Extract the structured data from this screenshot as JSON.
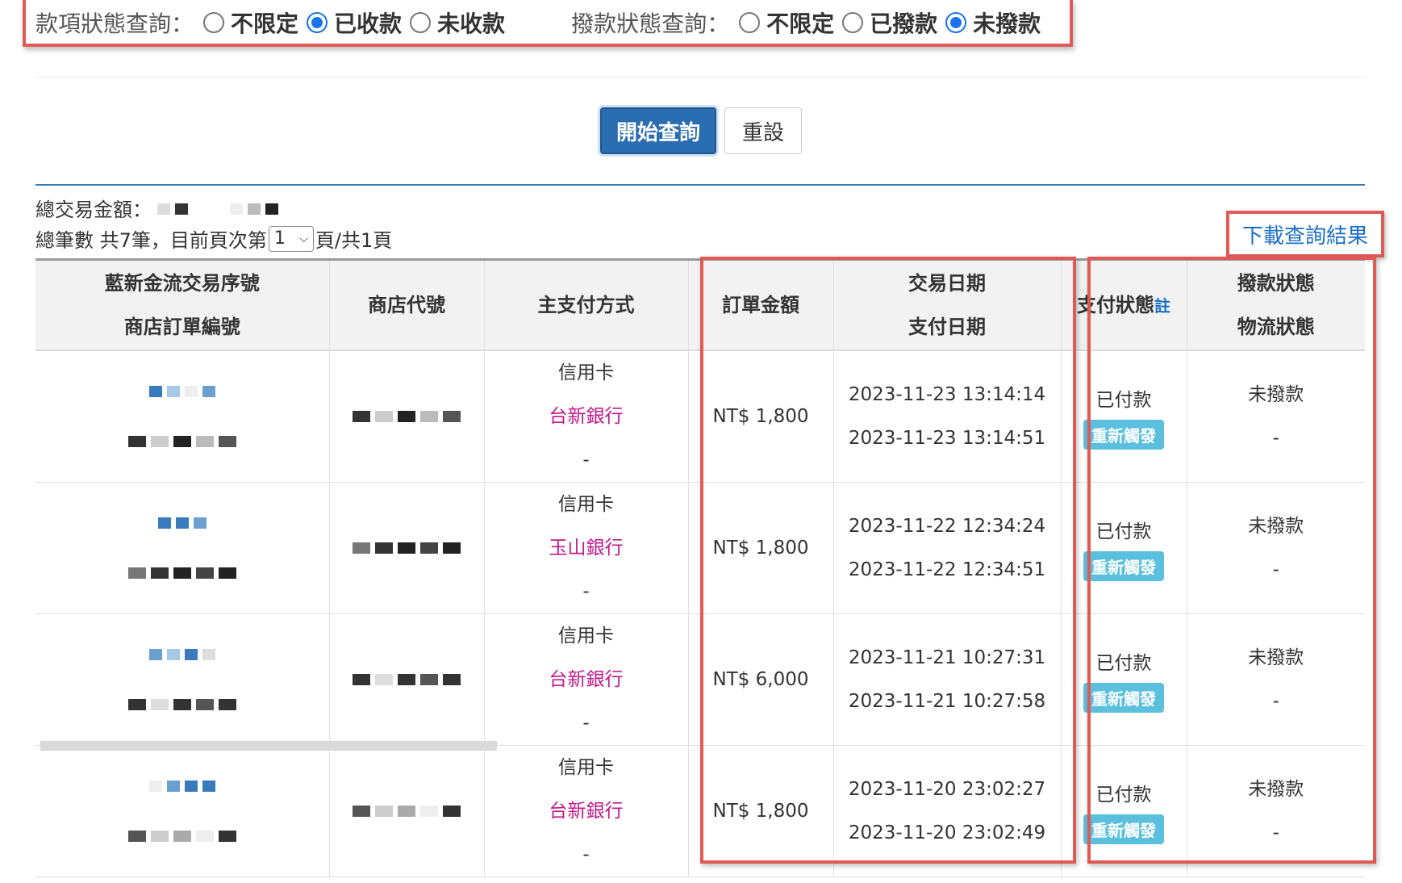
{
  "filters": {
    "payment_label": "款項狀態查詢：",
    "payment_options": [
      {
        "label": "不限定",
        "checked": false
      },
      {
        "label": "已收款",
        "checked": true
      },
      {
        "label": "未收款",
        "checked": false
      }
    ],
    "remit_label": "撥款狀態查詢：",
    "remit_options": [
      {
        "label": "不限定",
        "checked": false
      },
      {
        "label": "已撥款",
        "checked": false
      },
      {
        "label": "未撥款",
        "checked": true
      }
    ]
  },
  "buttons": {
    "search": "開始查詢",
    "reset": "重設"
  },
  "summary": {
    "total_amount_label": "總交易金額：",
    "total_count_prefix": "總筆數 共7筆，目前頁次第",
    "page_value": "1",
    "page_suffix": "頁/共1頁"
  },
  "download_label": "下載查詢結果",
  "table": {
    "headers": {
      "trade_no": "藍新金流交易序號",
      "order_no": "商店訂單編號",
      "merchant_id": "商店代號",
      "payment_method": "主支付方式",
      "order_amount": "訂單金額",
      "trade_date": "交易日期",
      "pay_date": "支付日期",
      "pay_status": "支付狀態",
      "pay_status_note": "註",
      "remit_status": "撥款狀態",
      "logistics_status": "物流狀態"
    },
    "rows": [
      {
        "method": "信用卡",
        "bank": "台新銀行",
        "extra": "-",
        "amount": "NT$ 1,800",
        "trade_date": "2023-11-23 13:14:14",
        "pay_date": "2023-11-23 13:14:51",
        "pay_status": "已付款",
        "resend": "重新觸發",
        "remit": "未撥款",
        "logistics": "-"
      },
      {
        "method": "信用卡",
        "bank": "玉山銀行",
        "extra": "-",
        "amount": "NT$ 1,800",
        "trade_date": "2023-11-22 12:34:24",
        "pay_date": "2023-11-22 12:34:51",
        "pay_status": "已付款",
        "resend": "重新觸發",
        "remit": "未撥款",
        "logistics": "-"
      },
      {
        "method": "信用卡",
        "bank": "台新銀行",
        "extra": "-",
        "amount": "NT$ 6,000",
        "trade_date": "2023-11-21 10:27:31",
        "pay_date": "2023-11-21 10:27:58",
        "pay_status": "已付款",
        "resend": "重新觸發",
        "remit": "未撥款",
        "logistics": "-"
      },
      {
        "method": "信用卡",
        "bank": "台新銀行",
        "extra": "-",
        "amount": "NT$ 1,800",
        "trade_date": "2023-11-20 23:02:27",
        "pay_date": "2023-11-20 23:02:49",
        "pay_status": "已付款",
        "resend": "重新觸發",
        "remit": "未撥款",
        "logistics": "-"
      }
    ]
  },
  "colors": {
    "accent": "#2a6db0",
    "highlight": "#e05a55",
    "bank": "#c2188b",
    "resend": "#5bc0de",
    "link": "#1a6fc9"
  }
}
